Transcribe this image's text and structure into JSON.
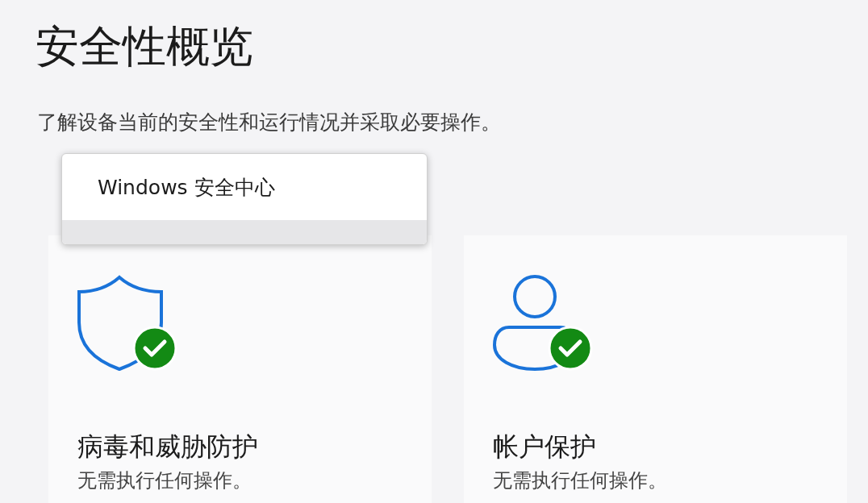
{
  "title": "安全性概览",
  "subtitle": "了解设备当前的安全性和运行情况并采取必要操作。",
  "tooltip": {
    "text": "Windows 安全中心"
  },
  "cards": [
    {
      "kind": "shield",
      "title": "病毒和威胁防护",
      "status": "无需执行任何操作。"
    },
    {
      "kind": "person",
      "title": "帐户保护",
      "status": "无需执行任何操作。"
    }
  ]
}
